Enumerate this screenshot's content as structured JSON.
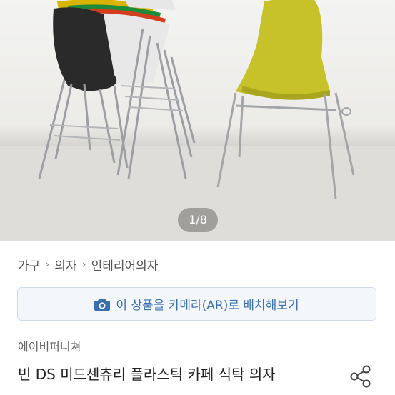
{
  "gallery": {
    "page_indicator": "1/8"
  },
  "breadcrumb": {
    "items": [
      "가구",
      "의자",
      "인테리어의자"
    ],
    "separator": "›"
  },
  "ar_button": {
    "icon": "camera-icon",
    "label": "이 상품을 카메라(AR)로 배치해보기"
  },
  "product": {
    "brand": "에이비퍼니쳐",
    "title": "빈 DS 미드센츄리 플라스틱 카페 식탁 의자",
    "share_icon": "share-icon"
  },
  "colors": {
    "accent": "#3a6fb0",
    "ar_button_bg": "#f3f7fc",
    "chair_yellow": "#c7c22a"
  }
}
